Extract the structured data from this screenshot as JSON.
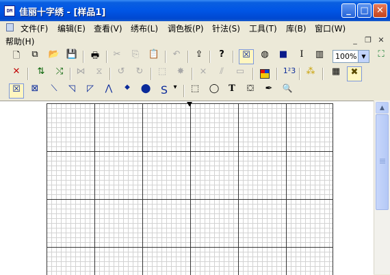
{
  "window": {
    "title": "佳丽十字绣 - [样品1]",
    "app_icon_text": "DM"
  },
  "title_buttons": {
    "minimize": "_",
    "maximize": "□",
    "close": "✕"
  },
  "menu": {
    "items": [
      "文件(F)",
      "编辑(E)",
      "查看(V)",
      "绣布(L)",
      "调色板(P)",
      "针法(S)",
      "工具(T)",
      "库(B)",
      "窗口(W)",
      "帮助(H)"
    ]
  },
  "mdi_buttons": {
    "minimize": "_",
    "restore": "❐",
    "close": "✕"
  },
  "toolbar1": {
    "zoom_value": "100%",
    "zoom_arrow": "▼",
    "icons": [
      "new-icon",
      "open-copy-icon",
      "open-folder-icon",
      "save-icon",
      "print-icon",
      "cut-icon",
      "copy-icon",
      "paste-icon",
      "undo-icon",
      "import-icon",
      "help-icon",
      "full-stitch-toggle-icon",
      "fill-toggle-icon",
      "color-block-icon",
      "text-cursor-icon",
      "library-icon",
      "zoom-select",
      "fit-icon"
    ],
    "glyphs": {
      "new": "🗋",
      "open_copy": "⧉",
      "open": "📂",
      "save": "💾",
      "print": "🖶",
      "cut": "✂",
      "copy": "⎘",
      "paste": "📋",
      "undo": "↶",
      "import": "⇪",
      "help": "?",
      "stitch": "☒",
      "fill": "◍",
      "block": "■",
      "text": "I",
      "lib": "▥",
      "fit": "⛶"
    }
  },
  "toolbar2": {
    "glyphs": {
      "delete": "✕",
      "colorize": "⇅",
      "swap": "⤭",
      "flip_h": "⋈",
      "flip_v": "⧖",
      "rot_l": "↺",
      "rot_r": "↻",
      "sel_a": "⬚",
      "sel_b": "✸",
      "mirror_a": "⨯",
      "mirror_b": "⫽",
      "frame": "▭",
      "palette": "▦",
      "number": "1²3",
      "pattern": "⁂",
      "grid": "▦",
      "cross": "✖"
    }
  },
  "toolbar3": {
    "glyphs": {
      "full_cross": "☒",
      "half_cross": "⊠",
      "backstitch": "⟍",
      "half_back": "◹",
      "quarter": "◸",
      "french": "⋀",
      "bead_small": "◆",
      "bead_big": "⬤",
      "curve": "S",
      "dropdown": "▾",
      "rect_select": "⬚",
      "lasso": "◯",
      "text": "T",
      "fill_bucket": "⛋",
      "eyedropper": "✒",
      "magnifier": "🔍"
    }
  },
  "scrollbar": {
    "up_arrow": "▲"
  }
}
